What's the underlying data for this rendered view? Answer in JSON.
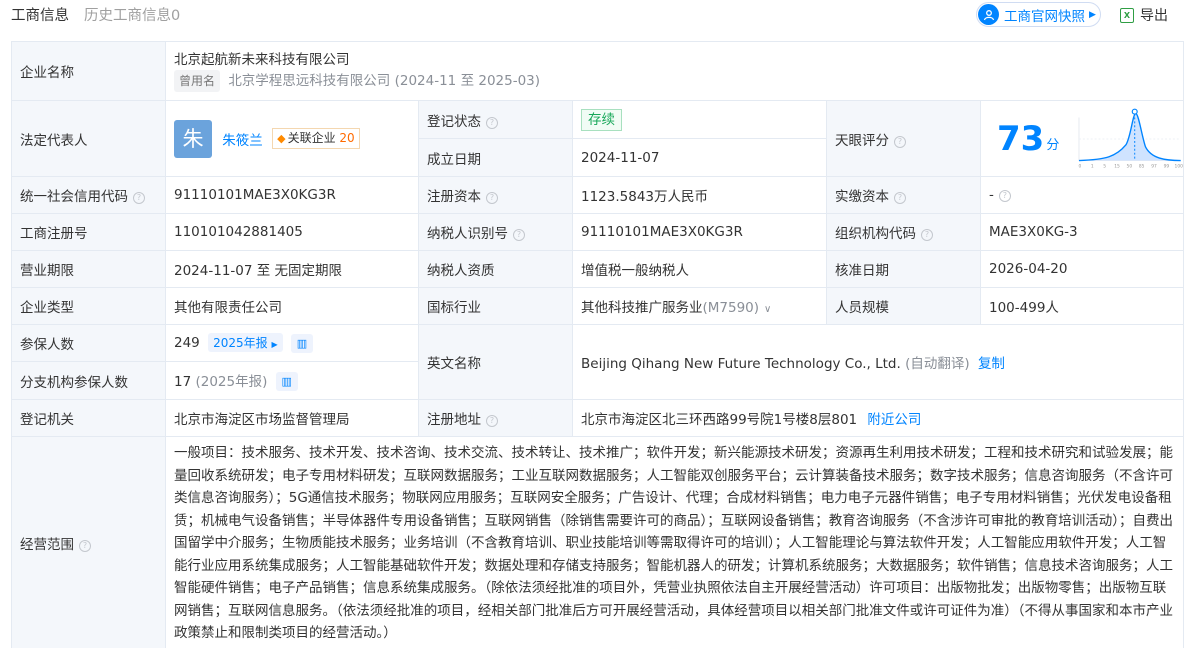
{
  "tabs": {
    "active": "工商信息",
    "history": "历史工商信息0"
  },
  "actions": {
    "snapshot": "工商官网快照",
    "export": "导出"
  },
  "company": {
    "name_label": "企业名称",
    "name": "北京起航新未来科技有限公司",
    "former_tag": "曾用名",
    "former_name": "北京学程思远科技有限公司 (2024-11 至 2025-03)"
  },
  "legal": {
    "label": "法定代表人",
    "avatar_char": "朱",
    "name": "朱筱兰",
    "related_label": "关联企业",
    "related_count": "20"
  },
  "status": {
    "label": "登记状态",
    "value": "存续"
  },
  "founded": {
    "label": "成立日期",
    "value": "2024-11-07"
  },
  "tianyan": {
    "label": "天眼评分",
    "score": "73",
    "unit": "分",
    "ticks": [
      "0",
      "1",
      "5",
      "15",
      "50",
      "85",
      "97",
      "99",
      "100"
    ]
  },
  "credit_code": {
    "label": "统一社会信用代码",
    "value": "91110101MAE3X0KG3R"
  },
  "reg_capital": {
    "label": "注册资本",
    "value": "1123.5843万人民币"
  },
  "paid_capital": {
    "label": "实缴资本",
    "value": "-"
  },
  "reg_no": {
    "label": "工商注册号",
    "value": "110101042881405"
  },
  "taxpayer_id": {
    "label": "纳税人识别号",
    "value": "91110101MAE3X0KG3R"
  },
  "org_code": {
    "label": "组织机构代码",
    "value": "MAE3X0KG-3"
  },
  "term": {
    "label": "营业期限",
    "value": "2024-11-07 至 无固定期限"
  },
  "taxpayer_type": {
    "label": "纳税人资质",
    "value": "增值税一般纳税人"
  },
  "approval_date": {
    "label": "核准日期",
    "value": "2026-04-20"
  },
  "company_type": {
    "label": "企业类型",
    "value": "其他有限责任公司"
  },
  "industry": {
    "label": "国标行业",
    "value": "其他科技推广服务业",
    "code": "(M7590)"
  },
  "staff": {
    "label": "人员规模",
    "value": "100-499人"
  },
  "insured": {
    "label": "参保人数",
    "value": "249",
    "report": "2025年报"
  },
  "branch_insured": {
    "label": "分支机构参保人数",
    "value": "17",
    "year": "(2025年报)"
  },
  "english": {
    "label": "英文名称",
    "value": "Beijing Qihang New Future Technology Co., Ltd.",
    "auto": "(自动翻译)",
    "copy": "复制"
  },
  "authority": {
    "label": "登记机关",
    "value": "北京市海淀区市场监督管理局"
  },
  "address": {
    "label": "注册地址",
    "value": "北京市海淀区北三环西路99号院1号楼8层801",
    "nearby": "附近公司"
  },
  "scope": {
    "label": "经营范围",
    "text": "一般项目：技术服务、技术开发、技术咨询、技术交流、技术转让、技术推广；软件开发；新兴能源技术研发；资源再生利用技术研发；工程和技术研究和试验发展；能量回收系统研发；电子专用材料研发；互联网数据服务；工业互联网数据服务；人工智能双创服务平台；云计算装备技术服务；数字技术服务；信息咨询服务（不含许可类信息咨询服务）；5G通信技术服务；物联网应用服务；互联网安全服务；广告设计、代理；合成材料销售；电力电子元器件销售；电子专用材料销售；光伏发电设备租赁；机械电气设备销售；半导体器件专用设备销售；互联网销售（除销售需要许可的商品）；互联网设备销售；教育咨询服务（不含涉许可审批的教育培训活动）；自费出国留学中介服务；生物质能技术服务；业务培训（不含教育培训、职业技能培训等需取得许可的培训）；人工智能理论与算法软件开发；人工智能应用软件开发；人工智能行业应用系统集成服务；人工智能基础软件开发；数据处理和存储支持服务；智能机器人的研发；计算机系统服务；大数据服务；软件销售；信息技术咨询服务；人工智能硬件销售；电子产品销售；信息系统集成服务。（除依法须经批准的项目外，凭营业执照依法自主开展经营活动）许可项目：出版物批发；出版物零售；出版物互联网销售；互联网信息服务。（依法须经批准的项目，经相关部门批准后方可开展经营活动，具体经营项目以相关部门批准文件或许可证件为准）（不得从事国家和本市产业政策禁止和限制类项目的经营活动。）"
  }
}
